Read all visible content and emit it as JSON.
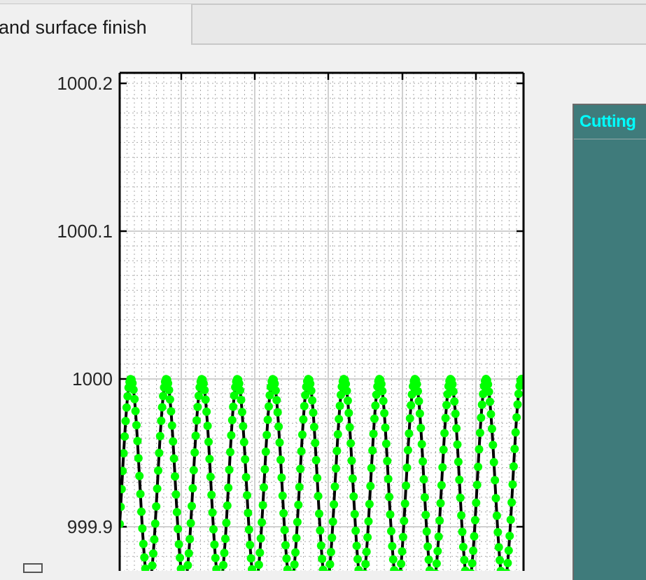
{
  "tabs": {
    "active_label": "and surface finish"
  },
  "panel": {
    "title": "Cutting"
  },
  "colors": {
    "marker": "#00ff00",
    "line": "#000000",
    "panel_bg": "#3f7b7b",
    "panel_title": "#00ffff"
  },
  "chart_data": {
    "type": "line",
    "title": "",
    "xlabel": "",
    "ylabel": "",
    "ylim": [
      999.86,
      1000.2
    ],
    "yticks": [
      {
        "value": 1000.2,
        "label": "1000.2"
      },
      {
        "value": 1000.1,
        "label": "1000.1"
      },
      {
        "value": 1000,
        "label": "1000"
      },
      {
        "value": 999.9,
        "label": "999.9"
      }
    ],
    "grid": true,
    "minor_grid": true,
    "markers": "filled-circle",
    "series": [
      {
        "x_start": 0,
        "x_end": 10.8,
        "peak_positions": [
          0.3,
          1.25,
          2.2,
          3.15,
          4.1,
          5.05,
          6.0,
          6.95,
          7.9,
          8.85,
          9.8
        ],
        "peak_value": 1000,
        "trough_value": 999.86,
        "samples_per_cycle": 36
      }
    ]
  }
}
